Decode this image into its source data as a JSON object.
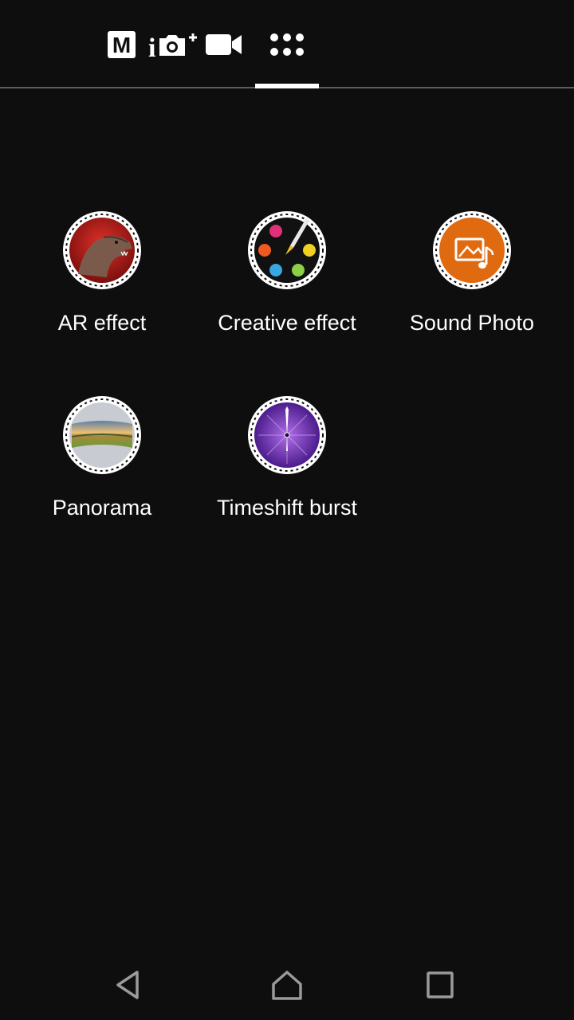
{
  "mode_bar": {
    "modes": [
      {
        "name": "manual",
        "icon": "manual-mode-icon",
        "glyph": "M"
      },
      {
        "name": "superior-auto",
        "icon": "superior-auto-icon",
        "glyph": "i"
      },
      {
        "name": "video",
        "icon": "video-camera-icon"
      },
      {
        "name": "camera-apps",
        "icon": "apps-grid-icon"
      }
    ],
    "selected": "camera-apps"
  },
  "apps": [
    {
      "label": "AR effect",
      "icon": "ar-effect-dinosaur-icon"
    },
    {
      "label": "Creative effect",
      "icon": "creative-effect-palette-icon"
    },
    {
      "label": "Sound Photo",
      "icon": "sound-photo-icon"
    },
    {
      "label": "Panorama",
      "icon": "panorama-icon"
    },
    {
      "label": "Timeshift burst",
      "icon": "timeshift-burst-icon"
    }
  ],
  "nav_bar": {
    "buttons": [
      {
        "name": "back",
        "icon": "back-triangle-icon"
      },
      {
        "name": "home",
        "icon": "home-icon"
      },
      {
        "name": "recents",
        "icon": "recents-square-icon"
      }
    ]
  },
  "colors": {
    "background": "#0f0e0e",
    "sound_photo_orange": "#e06a10",
    "timeshift_purple": "#6a2fb0",
    "indicator": "#ffffff"
  }
}
